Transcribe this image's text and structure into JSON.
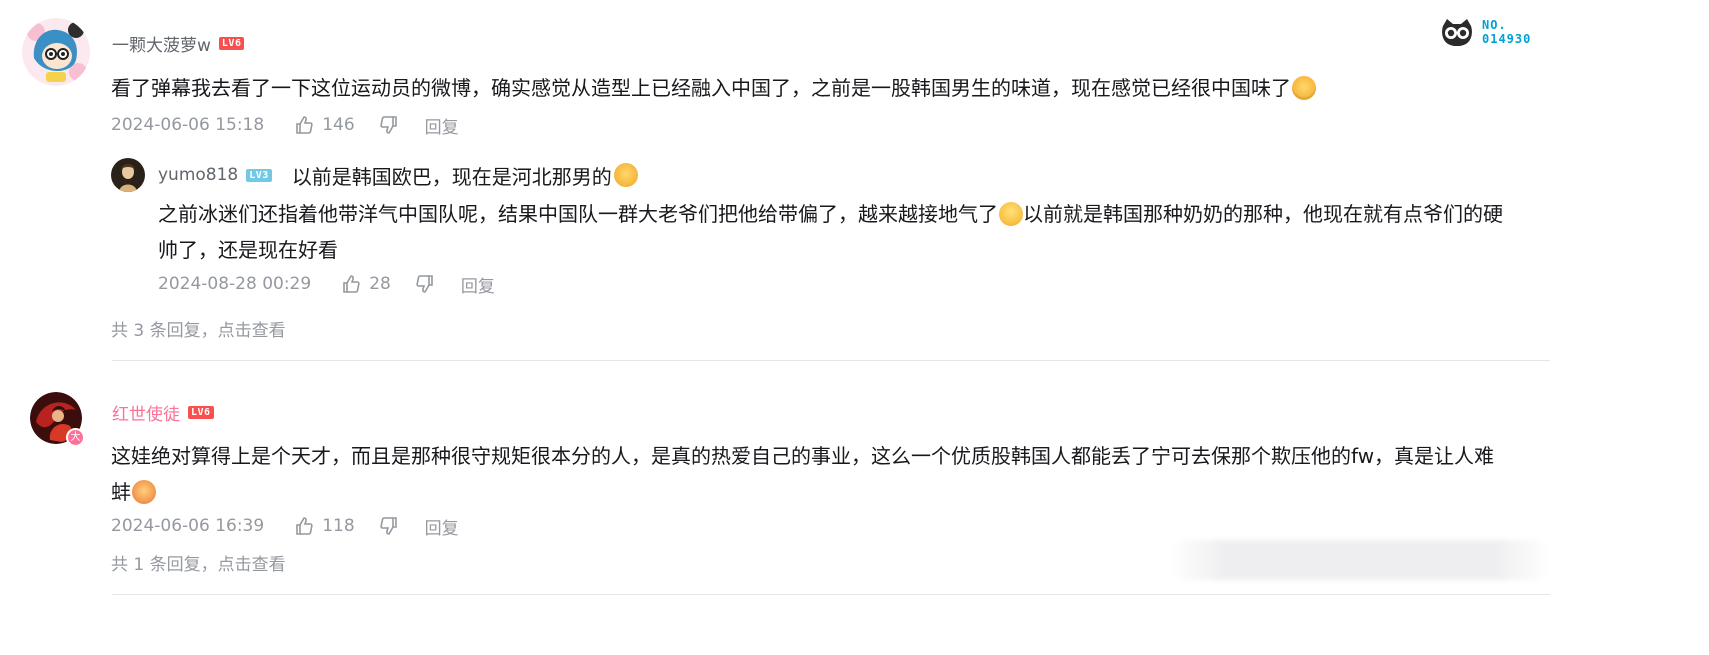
{
  "fan_badge": {
    "label_top": "NO.",
    "label_bottom": "014930"
  },
  "comments": [
    {
      "username": "一颗大菠萝w",
      "level": "LV6",
      "text": "看了弹幕我去看了一下这位运动员的微博，确实感觉从造型上已经融入中国了，之前是一股韩国男生的味道，现在感觉已经很中国味了",
      "time": "2024-06-06 15:18",
      "likes": "146",
      "reply_label": "回复",
      "sub_replies": [
        {
          "username": "yumo818",
          "level": "LV3",
          "first_line": "以前是韩国欧巴，现在是河北那男的",
          "text_part1": "之前冰迷们还指着他带洋气中国队呢，结果中国队一群大老爷们把他给带偏了，越来越接地气了",
          "text_part2": "以前就是韩国那种奶奶的那种，他现在就有点爷们的硬",
          "text_line2": "帅了，还是现在好看",
          "time": "2024-08-28 00:29",
          "likes": "28",
          "reply_label": "回复"
        }
      ],
      "reply_total": "共 3 条回复，点击查看"
    },
    {
      "username": "红世使徒",
      "level": "LV6",
      "avatar_badge": "大",
      "text_line1": "这娃绝对算得上是个天才，而且是那种很守规矩很本分的人，是真的热爱自己的事业，这么一个优质股韩国人都能丢了宁可去保那个欺压他的fw，真是让人难",
      "text_line2": "蚌",
      "time": "2024-06-06 16:39",
      "likes": "118",
      "reply_label": "回复",
      "reply_total": "共 1 条回复，点击查看"
    }
  ],
  "colors": {
    "accent": "#fb7299",
    "lv6": "#f84f4f",
    "lv3": "#73c9e5",
    "muted": "#9499a0"
  }
}
